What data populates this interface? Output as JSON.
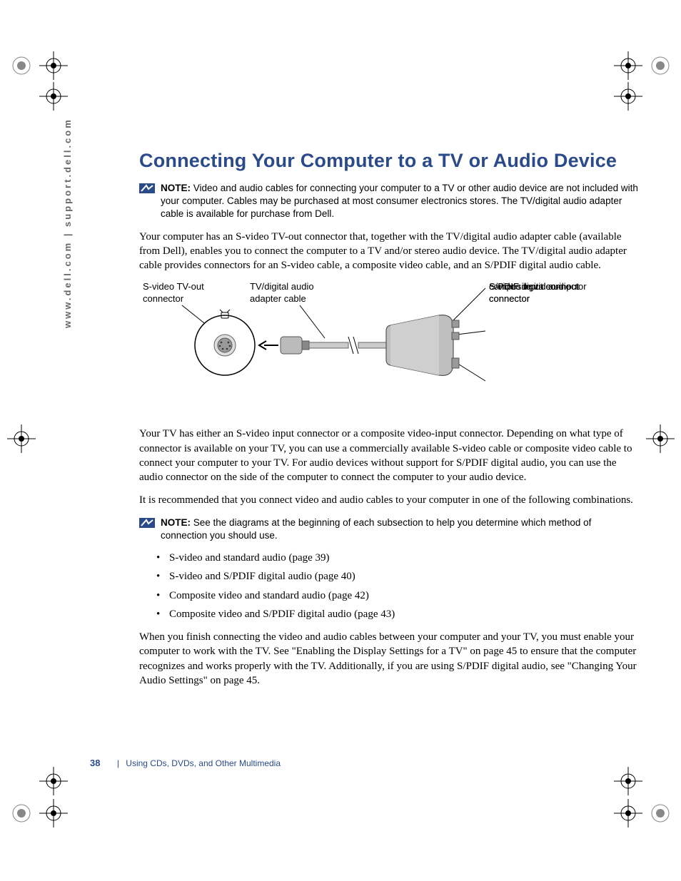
{
  "sidebar": "www.dell.com | support.dell.com",
  "heading": "Connecting Your Computer to a TV or Audio Device",
  "note1": {
    "label": "NOTE:",
    "text": "Video and audio cables for connecting your computer to a TV or other audio device are not included with your computer. Cables may be purchased at most consumer electronics stores. The TV/digital audio adapter cable is available for purchase from Dell."
  },
  "para1": "Your computer has an S-video TV-out connector that, together with the TV/digital audio adapter cable (available from Dell), enables you to connect the computer to a TV and/or stereo audio device. The TV/digital audio adapter cable provides connectors for an S-video cable, a composite video cable, and an S/PDIF digital audio cable.",
  "diagram": {
    "label_svideo_out": "S-video TV-out connector",
    "label_adapter": "TV/digital audio adapter cable",
    "label_spdif": "S/PDIF digital audio connector",
    "label_composite": "composite video-input connector",
    "label_svideo_in": "S-video input connector"
  },
  "para2": "Your TV has either an S-video input connector or a composite video-input connector. Depending on what type of connector is available on your TV, you can use a commercially available S-video cable or composite video cable to connect your computer to your TV. For audio devices without support for S/PDIF digital audio, you can use the audio connector on the side of the computer to connect the computer to your audio device.",
  "para3": "It is recommended that you connect video and audio cables to your computer in one of the following combinations.",
  "note2": {
    "label": "NOTE:",
    "text": "See the diagrams at the beginning of each subsection to help you determine which method of connection you should use."
  },
  "bullets": [
    "S-video and standard audio (page 39)",
    "S-video and S/PDIF digital audio (page 40)",
    "Composite video and standard audio (page 42)",
    "Composite video and S/PDIF digital audio (page 43)"
  ],
  "para4": "When you finish connecting the video and audio cables between your computer and your TV, you must enable your computer to work with the TV. See \"Enabling the Display Settings for a TV\" on page 45 to ensure that the computer recognizes and works properly with the TV. Additionally, if you are using S/PDIF digital audio, see \"Changing Your Audio Settings\" on page 45.",
  "footer": {
    "page": "38",
    "section": "Using CDs, DVDs, and Other Multimedia"
  }
}
